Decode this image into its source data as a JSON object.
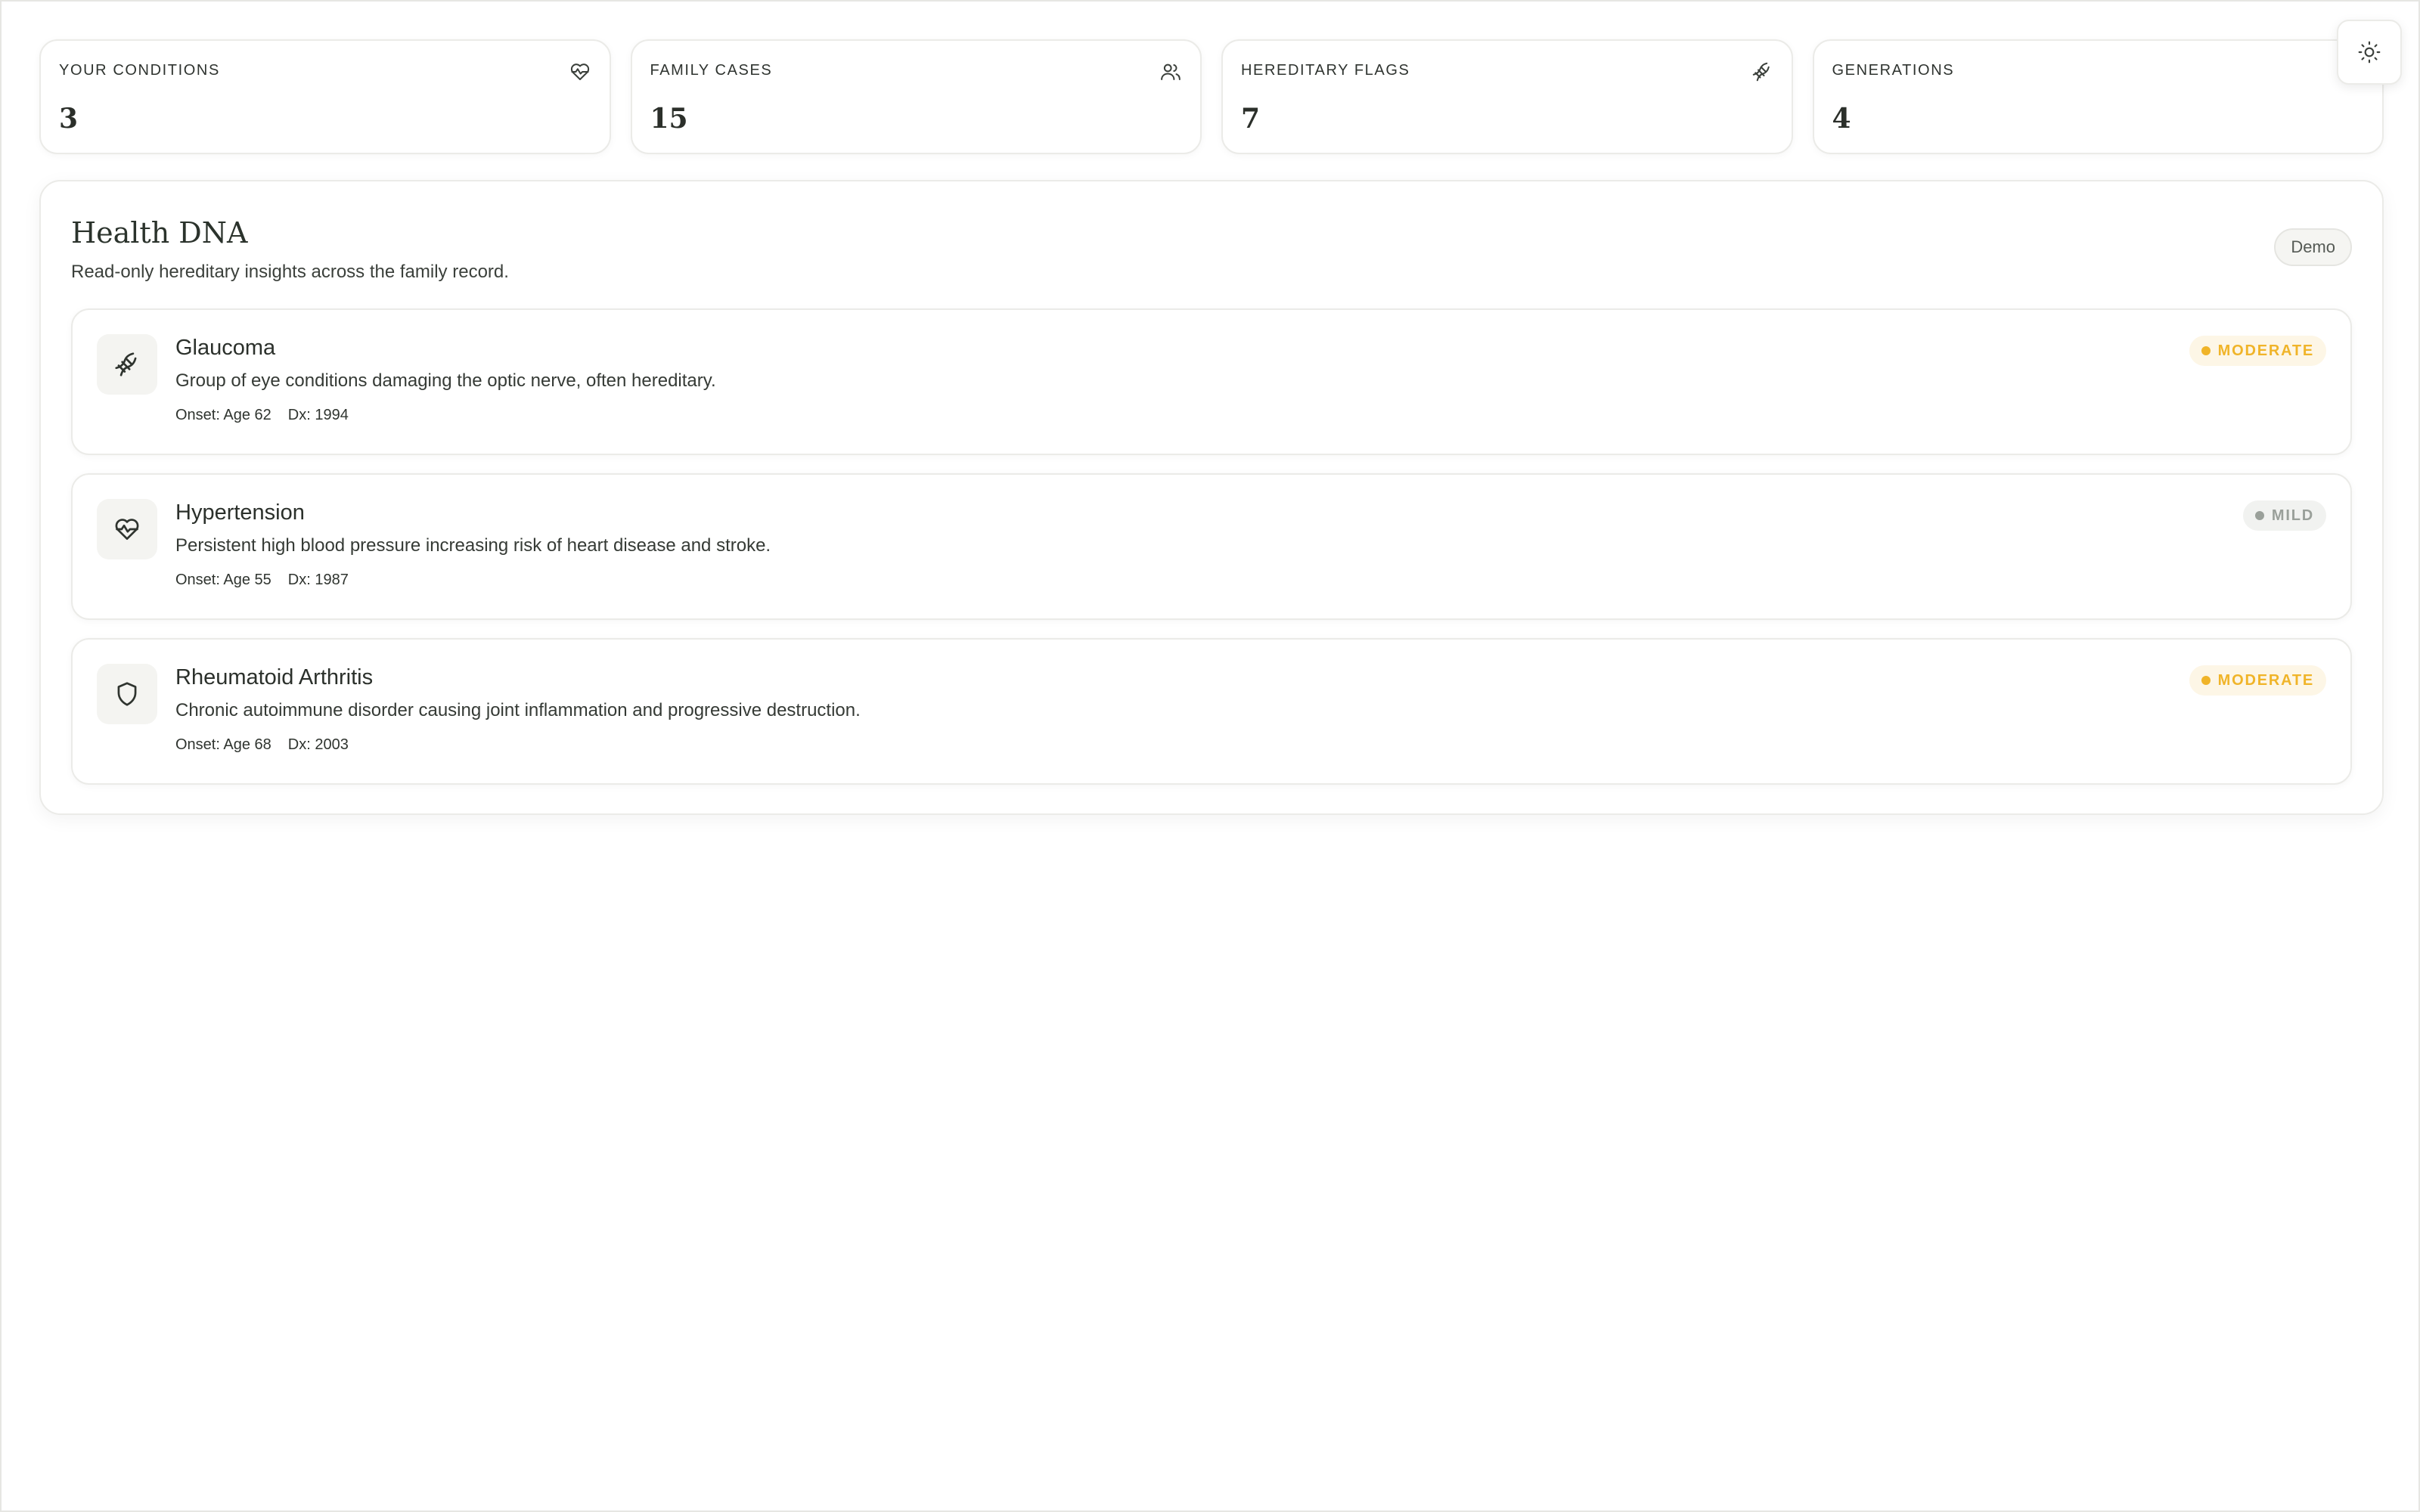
{
  "stats": [
    {
      "label": "YOUR CONDITIONS",
      "value": "3",
      "icon": "heart-pulse-icon"
    },
    {
      "label": "FAMILY CASES",
      "value": "15",
      "icon": "users-icon"
    },
    {
      "label": "HEREDITARY FLAGS",
      "value": "7",
      "icon": "dna-icon"
    },
    {
      "label": "GENERATIONS",
      "value": "4",
      "icon": null
    }
  ],
  "theme_toggle": {
    "icon": "sun-icon"
  },
  "panel": {
    "title": "Health DNA",
    "subtitle": "Read-only hereditary insights across the family record.",
    "badge": "Demo"
  },
  "conditions": [
    {
      "name": "Glaucoma",
      "description": "Group of eye conditions damaging the optic nerve, often hereditary.",
      "onset": "Onset: Age 62",
      "dx": "Dx: 1994",
      "severity": "MODERATE",
      "icon": "dna-icon"
    },
    {
      "name": "Hypertension",
      "description": "Persistent high blood pressure increasing risk of heart disease and stroke.",
      "onset": "Onset: Age 55",
      "dx": "Dx: 1987",
      "severity": "MILD",
      "icon": "heart-pulse-icon"
    },
    {
      "name": "Rheumatoid Arthritis",
      "description": "Chronic autoimmune disorder causing joint inflammation and progressive destruction.",
      "onset": "Onset: Age 68",
      "dx": "Dx: 2003",
      "severity": "MODERATE",
      "icon": "shield-icon"
    }
  ],
  "colors": {
    "moderate": "#f0b429",
    "mild": "#9aa09a",
    "text": "#2b2f2a"
  }
}
